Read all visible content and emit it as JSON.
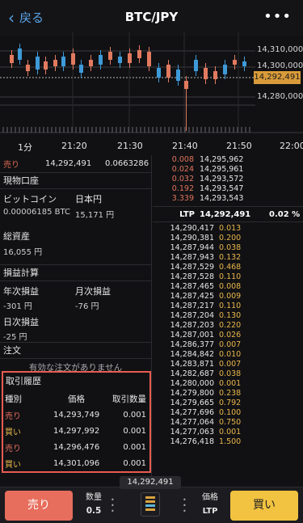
{
  "header": {
    "back_label": "戻る",
    "title": "BTC/JPY",
    "more_icon": "ellipsis-icon"
  },
  "chart": {
    "price_labels": [
      "14,310,000",
      "14,300,000",
      "14,292,491",
      "14,280,000"
    ],
    "time_labels": [
      "1分",
      "21:20",
      "21:30",
      "21:40",
      "21:50",
      "22:00"
    ]
  },
  "left": {
    "top_side": "売り",
    "top_price": "14,292,491",
    "top_qty": "0.0663286",
    "spot_header": "現物口座",
    "btc_label": "ビットコイン",
    "btc_value": "0.00006185 BTC",
    "jpy_label": "日本円",
    "jpy_value": "15,171 円",
    "total_label": "総資産",
    "total_value": "16,055 円",
    "pnl_header": "損益計算",
    "annual_label": "年次損益",
    "annual_value": "-301 円",
    "monthly_label": "月次損益",
    "monthly_value": "-76 円",
    "daily_label": "日次損益",
    "daily_value": "-25 円",
    "orders_header": "注文",
    "no_orders": "有効な注文がありません"
  },
  "history": {
    "title": "取引履歴",
    "col_type": "種別",
    "col_price": "価格",
    "col_qty": "取引数量",
    "rows": [
      {
        "side": "売り",
        "price": "14,293,749",
        "qty": "0.001"
      },
      {
        "side": "買い",
        "price": "14,297,992",
        "qty": "0.001"
      },
      {
        "side": "売り",
        "price": "14,296,476",
        "qty": "0.001"
      },
      {
        "side": "買い",
        "price": "14,301,096",
        "qty": "0.001"
      }
    ]
  },
  "book": {
    "asks": [
      {
        "qty": "0.008",
        "price": "14,295,962"
      },
      {
        "qty": "0.024",
        "price": "14,295,961"
      },
      {
        "qty": "0.032",
        "price": "14,293,572"
      },
      {
        "qty": "0.192",
        "price": "14,293,547"
      },
      {
        "qty": "3.339",
        "price": "14,293,543"
      }
    ],
    "ltp_label": "LTP",
    "ltp_price": "14,292,491",
    "ltp_change": "0.02 %",
    "bids": [
      {
        "price": "14,290,417",
        "qty": "0.013"
      },
      {
        "price": "14,290,381",
        "qty": "0.200"
      },
      {
        "price": "14,287,944",
        "qty": "0.038"
      },
      {
        "price": "14,287,943",
        "qty": "0.132"
      },
      {
        "price": "14,287,529",
        "qty": "0.468"
      },
      {
        "price": "14,287,528",
        "qty": "0.110"
      },
      {
        "price": "14,287,465",
        "qty": "0.008"
      },
      {
        "price": "14,287,425",
        "qty": "0.009"
      },
      {
        "price": "14,287,217",
        "qty": "0.110"
      },
      {
        "price": "14,287,204",
        "qty": "0.130"
      },
      {
        "price": "14,287,203",
        "qty": "0.220"
      },
      {
        "price": "14,287,001",
        "qty": "0.026"
      },
      {
        "price": "14,286,377",
        "qty": "0.007"
      },
      {
        "price": "14,284,842",
        "qty": "0.010"
      },
      {
        "price": "14,283,871",
        "qty": "0.007"
      },
      {
        "price": "14,282,687",
        "qty": "0.038"
      },
      {
        "price": "14,280,000",
        "qty": "0.001"
      },
      {
        "price": "14,279,800",
        "qty": "0.238"
      },
      {
        "price": "14,279,665",
        "qty": "0.792"
      },
      {
        "price": "14,277,696",
        "qty": "0.100"
      },
      {
        "price": "14,277,064",
        "qty": "0.750"
      },
      {
        "price": "14,277,063",
        "qty": "0.001"
      },
      {
        "price": "14,276,418",
        "qty": "1.500"
      }
    ]
  },
  "bottom": {
    "sell_label": "売り",
    "buy_label": "買い",
    "qty_label": "数量",
    "qty_value": "0.5",
    "price_label": "価格",
    "price_value": "LTP",
    "current_price": "14,292,491"
  },
  "colors": {
    "sell": "#e76d5c",
    "buy": "#f2c241",
    "bid_qty": "#e8b64a",
    "ask_qty": "#e0745a",
    "highlight": "#e65c50"
  }
}
